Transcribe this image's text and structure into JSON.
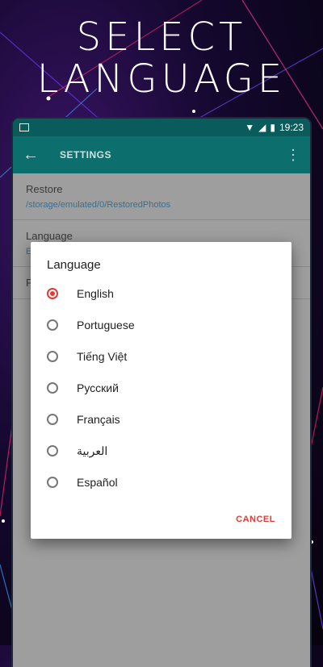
{
  "promo": {
    "line1": "SELECT",
    "line2": "LANGUAGE"
  },
  "statusbar": {
    "time": "19:23"
  },
  "toolbar": {
    "title": "SETTINGS",
    "back_icon": "arrow-back-icon",
    "more_icon": "more-vert-icon"
  },
  "prefs": [
    {
      "title": "Restore",
      "summary": "/storage/emulated/0/RestoredPhotos"
    },
    {
      "title": "Language",
      "summary": "E"
    },
    {
      "title": "P",
      "summary": ""
    }
  ],
  "dialog": {
    "title": "Language",
    "options": [
      {
        "label": "English",
        "selected": true
      },
      {
        "label": "Portuguese",
        "selected": false
      },
      {
        "label": "Tiếng Việt",
        "selected": false
      },
      {
        "label": "Русский",
        "selected": false
      },
      {
        "label": "Français",
        "selected": false
      },
      {
        "label": "العربية",
        "selected": false
      },
      {
        "label": "Español",
        "selected": false
      }
    ],
    "cancel_label": "CANCEL"
  },
  "colors": {
    "toolbar": "#0d6e6e",
    "accent": "#e53935",
    "background": "#14082e"
  }
}
